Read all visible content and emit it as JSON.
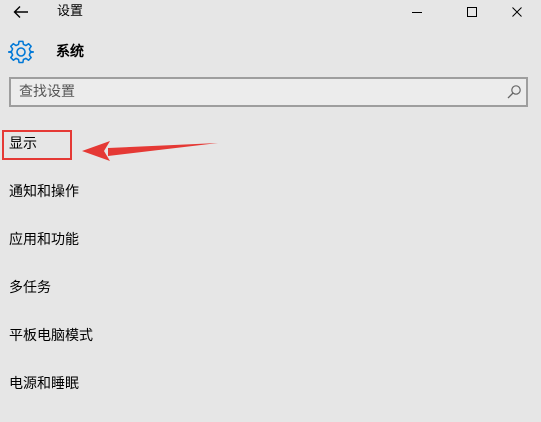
{
  "window": {
    "title": "设置"
  },
  "header": {
    "title": "系统",
    "icon": "gear-icon"
  },
  "search": {
    "placeholder": "查找设置",
    "value": ""
  },
  "menu": {
    "items": [
      {
        "label": "显示"
      },
      {
        "label": "通知和操作"
      },
      {
        "label": "应用和功能"
      },
      {
        "label": "多任务"
      },
      {
        "label": "平板电脑模式"
      },
      {
        "label": "电源和睡眠"
      }
    ]
  },
  "colors": {
    "background": "#e6e6e6",
    "accent": "#0078d7",
    "annotation": "#e53935"
  }
}
